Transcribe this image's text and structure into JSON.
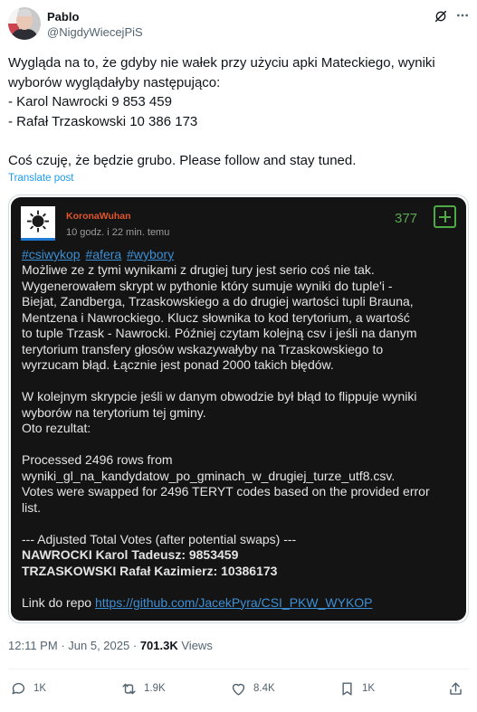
{
  "author": {
    "display_name": "Pablo",
    "handle": "@NigdyWiecejPiS"
  },
  "tweet": {
    "lines": [
      "Wygląda na to, że gdyby nie wałek przy użyciu apki Mateckiego, wyniki",
      "wyborów wyglądałyby następująco:",
      "- Karol Nawrocki 9 853 459",
      "- Rafał Trzaskowski 10 386 173",
      "",
      "Coś czuję, że będzie grubo. Please follow and stay tuned."
    ],
    "translate_label": "Translate post"
  },
  "embedded": {
    "username": "KoronaWuhan",
    "time": "10 godz. i 22 min. temu",
    "score": "377",
    "tags": [
      "#csiwykop",
      "#afera",
      "#wybory"
    ],
    "body_lines": [
      "Możliwe ze z tymi wynikami z drugiej tury jest serio coś nie tak.",
      "Wygenerowałem skrypt w pythonie który sumuje wyniki do tuple'i -",
      "Biejat, Zandberga, Trzaskowskiego a do drugiej wartości tupli Brauna,",
      "Mentzena i Nawrockiego. Klucz słownika to kod terytorium, a wartość",
      "to tuple Trzask - Nawrocki. Później czytam kolejną csv i jeśli na danym",
      "terytorium transfery głosów wskazywałyby na Trzaskowskiego to",
      "wyrzucam błąd. Łącznie jest ponad 2000 takich błędów.",
      "",
      "W kolejnym skrypcie jeśli w danym obwodzie był błąd to flippuje wyniki",
      "wyborów na terytorium tej gminy.",
      "Oto rezultat:",
      "",
      "Processed 2496 rows from",
      "wyniki_gl_na_kandydatow_po_gminach_w_drugiej_turze_utf8.csv.",
      "Votes were swapped for 2496 TERYT codes based on the provided error",
      "list.",
      "",
      "--- Adjusted Total Votes (after potential swaps) ---"
    ],
    "bold_lines": [
      "NAWROCKI Karol Tadeusz: 9853459",
      "TRZASKOWSKI Rafał Kazimierz: 10386173"
    ],
    "repo_prefix": "Link do repo ",
    "repo_url": "https://github.com/JacekPyra/CSI_PKW_WYKOP"
  },
  "meta": {
    "time": "12:11 PM",
    "date": "Jun 5, 2025",
    "separator": "·",
    "views_count": "701.3K",
    "views_label": "Views"
  },
  "actions": {
    "reply_count": "1K",
    "retweet_count": "1.9K",
    "like_count": "8.4K",
    "bookmark_count": "1K"
  },
  "colors": {
    "link": "#1d9bf0",
    "embedded_bg": "#141414",
    "embedded_user": "#e2552b",
    "embedded_score": "#5ba852",
    "embedded_link": "#3d8fd4"
  },
  "icons": {
    "grok": "grok-icon",
    "more": "more-icon",
    "reply": "reply-icon",
    "retweet": "retweet-icon",
    "like": "heart-icon",
    "bookmark": "bookmark-icon",
    "share": "share-icon",
    "virus": "virus-icon"
  }
}
